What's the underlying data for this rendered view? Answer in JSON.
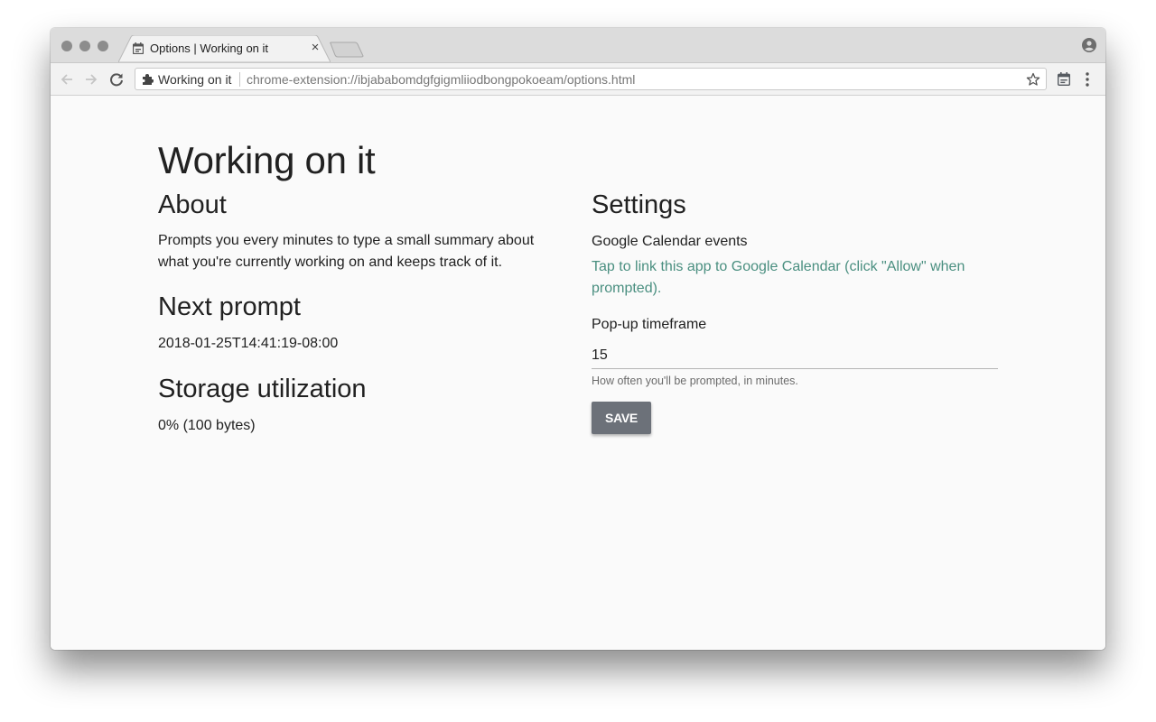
{
  "browser": {
    "tab": {
      "title": "Options | Working on it",
      "icon": "calendar-icon",
      "close_glyph": "×"
    },
    "omnibox": {
      "site_name": "Working on it",
      "url": "chrome-extension://ibjababomdgfgigmliiodbongpokoeam/options.html",
      "site_icon": "puzzle-piece-icon"
    },
    "icons": [
      "back-arrow-icon",
      "forward-arrow-icon",
      "reload-icon",
      "star-icon",
      "calendar-extension-icon",
      "more-vert-icon",
      "profile-icon"
    ]
  },
  "page": {
    "title": "Working on it",
    "about": {
      "heading": "About",
      "text": "Prompts you every minutes to type a small summary about what you're currently working on and keeps track of it."
    },
    "next_prompt": {
      "heading": "Next prompt",
      "value": "2018-01-25T14:41:19-08:00"
    },
    "storage": {
      "heading": "Storage utilization",
      "value": "0% (100 bytes)"
    },
    "settings": {
      "heading": "Settings",
      "calendar_label": "Google Calendar events",
      "calendar_link": "Tap to link this app to Google Calendar (click \"Allow\" when prompted).",
      "popup_label": "Pop-up timeframe",
      "popup_value": "15",
      "popup_helper": "How often you'll be prompted, in minutes.",
      "save_label": "SAVE"
    }
  }
}
